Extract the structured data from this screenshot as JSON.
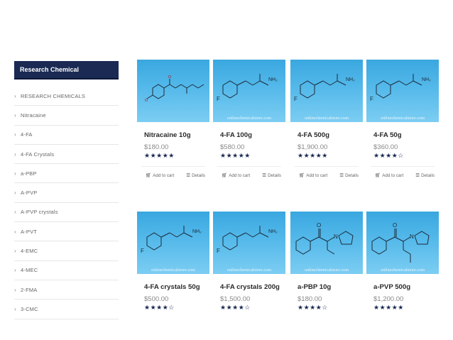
{
  "sidebar": {
    "title": "Research Chemical",
    "items": [
      {
        "label": "RESEARCH CHEMICALS"
      },
      {
        "label": "Nitracaine"
      },
      {
        "label": "4-FA"
      },
      {
        "label": "4-FA Crystals"
      },
      {
        "label": "a-PBP"
      },
      {
        "label": "A-PVP"
      },
      {
        "label": "A-PVP crystals"
      },
      {
        "label": "A-PVT"
      },
      {
        "label": "4-EMC"
      },
      {
        "label": "4-MEC"
      },
      {
        "label": "2-FMA"
      },
      {
        "label": "3-CMC"
      }
    ]
  },
  "products": [
    {
      "name": "Nitracaine 10g",
      "price": "$180.00",
      "rating": 5,
      "image": "nitracaine-structure",
      "watermark": "",
      "add_to_cart": "Add to cart",
      "details": "Details"
    },
    {
      "name": "4-FA 100g",
      "price": "$580.00",
      "rating": 5,
      "image": "4fa-structure",
      "watermark": "onlinechemicalstore.com",
      "add_to_cart": "Add to cart",
      "details": "Details"
    },
    {
      "name": "4-FA 500g",
      "price": "$1,900.00",
      "rating": 5,
      "image": "4fa-structure",
      "watermark": "onlinechemicalstore.com",
      "add_to_cart": "Add to cart",
      "details": "Details"
    },
    {
      "name": "4-FA 50g",
      "price": "$360.00",
      "rating": 4,
      "image": "4fa-structure",
      "watermark": "onlinechemicalstore.com",
      "add_to_cart": "Add to cart",
      "details": "Details"
    },
    {
      "name": "4-FA crystals 50g",
      "price": "$500.00",
      "rating": 4,
      "image": "4fa-structure",
      "watermark": "onlinechemicalstore.com"
    },
    {
      "name": "4-FA crystals 200g",
      "price": "$1,500.00",
      "rating": 4,
      "image": "4fa-structure",
      "watermark": "onlinechemicalstore.com"
    },
    {
      "name": "a-PBP 10g",
      "price": "$180.00",
      "rating": 4,
      "image": "apbp-structure",
      "watermark": "onlinechemicalstore.com"
    },
    {
      "name": "a-PVP 500g",
      "price": "$1,200.00",
      "rating": 5,
      "image": "apvp-structure",
      "watermark": "onlinechemicalstore.com"
    }
  ],
  "labels": {
    "nh2": "NH₂",
    "fluoro": "F",
    "nitrogen": "N",
    "oxygen": "O"
  },
  "colors": {
    "sidebar_header": "#1a2a52",
    "card_image": "#4fb4e8",
    "stars": "#1a2a52"
  },
  "icons": {
    "cart": "cart-icon",
    "details": "list-icon",
    "chevron": "chevron-right-icon",
    "star": "star-icon"
  }
}
